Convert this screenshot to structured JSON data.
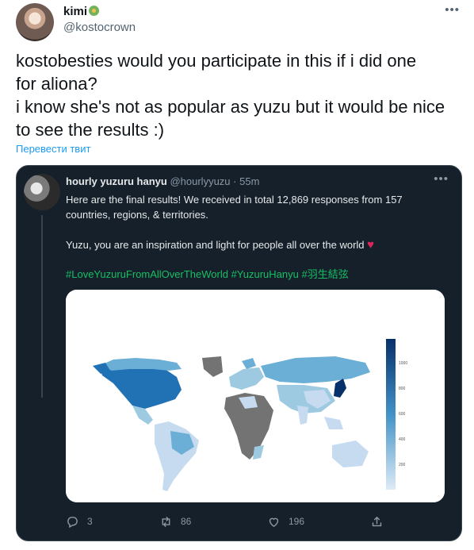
{
  "tweet": {
    "author": {
      "name": "kimi",
      "handle": "@kostocrown"
    },
    "more_glyph": "•••",
    "text_lines": [
      "kostobesties would you participate in this if i did one",
      "for aliona?",
      "i know she's not as popular as yuzu but it would be nice",
      "to see the results :)"
    ],
    "translate_label": "Перевести твит"
  },
  "quote": {
    "author_name": "hourly yuzuru hanyu",
    "author_handle": "@hourlyyuzu",
    "separator": " · ",
    "time": "55m",
    "more_glyph": "•••",
    "text_line1": "Here are the final results! We received in total 12,869 responses from 157",
    "text_line2": "countries, regions, & territories.",
    "text_line3": "Yuzu, you are an inspiration and light for people all over the world",
    "heart_emoji": "♥",
    "hashtags": "#LoveYuzuruFromAllOverTheWorld #YuzuruHanyu #羽生結弦",
    "colors": {
      "background": "#15202b",
      "hashtag": "#17bf63",
      "heart": "#e0245e"
    }
  },
  "map": {
    "legend_ticks": [
      "1000",
      "800",
      "600",
      "400",
      "200"
    ],
    "color_scale": [
      "#08306b",
      "#c6dbef"
    ]
  },
  "actions": {
    "reply_icon": "reply-icon",
    "reply_count": "3",
    "retweet_icon": "retweet-icon",
    "retweet_count": "86",
    "like_icon": "heart-icon",
    "like_count": "196",
    "share_icon": "share-icon"
  }
}
